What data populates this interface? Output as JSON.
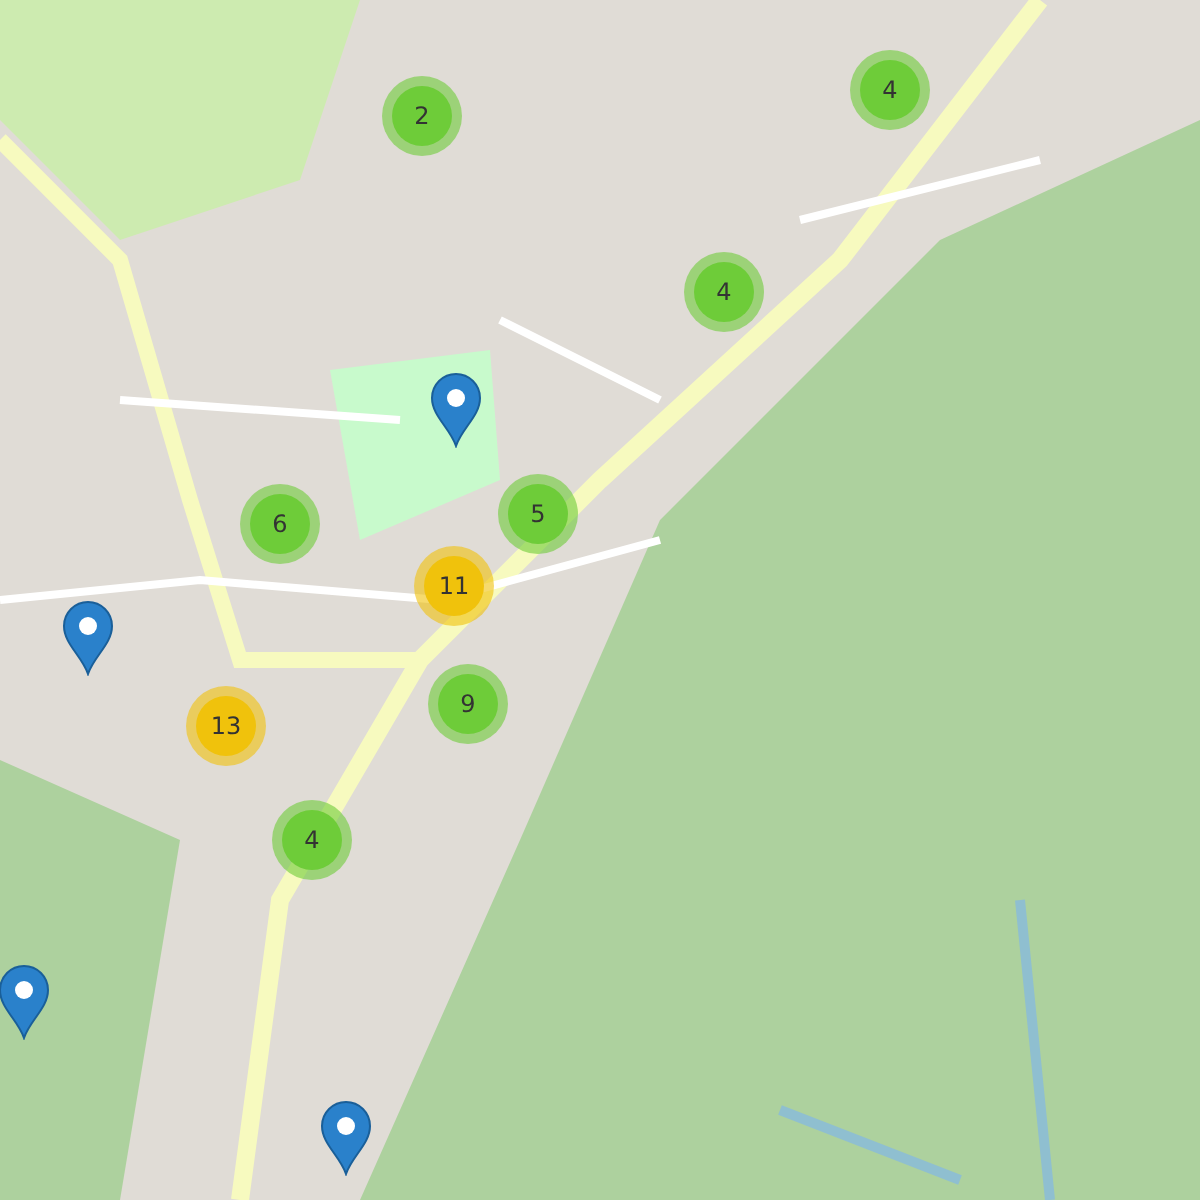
{
  "clusters": [
    {
      "count": "2",
      "color": "#6ecc39"
    },
    {
      "count": "4",
      "color": "#6ecc39"
    },
    {
      "count": "4",
      "color": "#6ecc39"
    },
    {
      "count": "6",
      "color": "#6ecc39"
    },
    {
      "count": "5",
      "color": "#6ecc39"
    },
    {
      "count": "11",
      "color": "#f0c20c"
    },
    {
      "count": "13",
      "color": "#f0c20c"
    },
    {
      "count": "9",
      "color": "#6ecc39"
    },
    {
      "count": "4",
      "color": "#6ecc39"
    }
  ],
  "pins": [
    {
      "kind": "marker"
    },
    {
      "kind": "marker"
    },
    {
      "kind": "marker"
    },
    {
      "kind": "marker"
    }
  ]
}
